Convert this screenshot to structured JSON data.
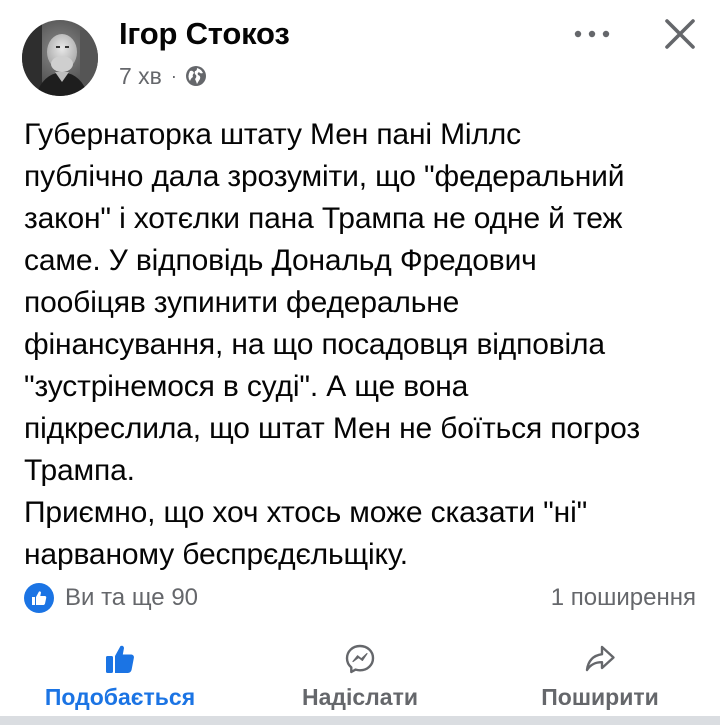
{
  "post": {
    "author": "Ігор Стокоз",
    "time": "7 хв",
    "separator": "·",
    "privacy_icon": "globe-icon",
    "text": "Губернаторка штату Мен пані Міллс\nпублічно дала зрозуміти, що \"федеральний\nзакон\" і хотєлки пана Трампа не одне й теж\nсаме. У відповідь Дональд Фредович\nпообіцяв зупинити федеральне\nфінансування, на що посадовця відповіла\n\"зустрінемося в суді\". А ще вона\nпідкреслила, що штат Мен не боїться погроз\nТрампа.\nПриємно, що хоч хтось може сказати \"ні\"\nнарваному беспрєдєльщіку."
  },
  "reactions": {
    "icon": "like-icon",
    "summary": "Ви та ще 90",
    "shares": "1 поширення"
  },
  "actions": {
    "like": "Подобається",
    "send": "Надіслати",
    "share": "Поширити"
  },
  "colors": {
    "accent": "#1b74e4",
    "secondary_text": "#65676b",
    "primary_text": "#050505"
  }
}
